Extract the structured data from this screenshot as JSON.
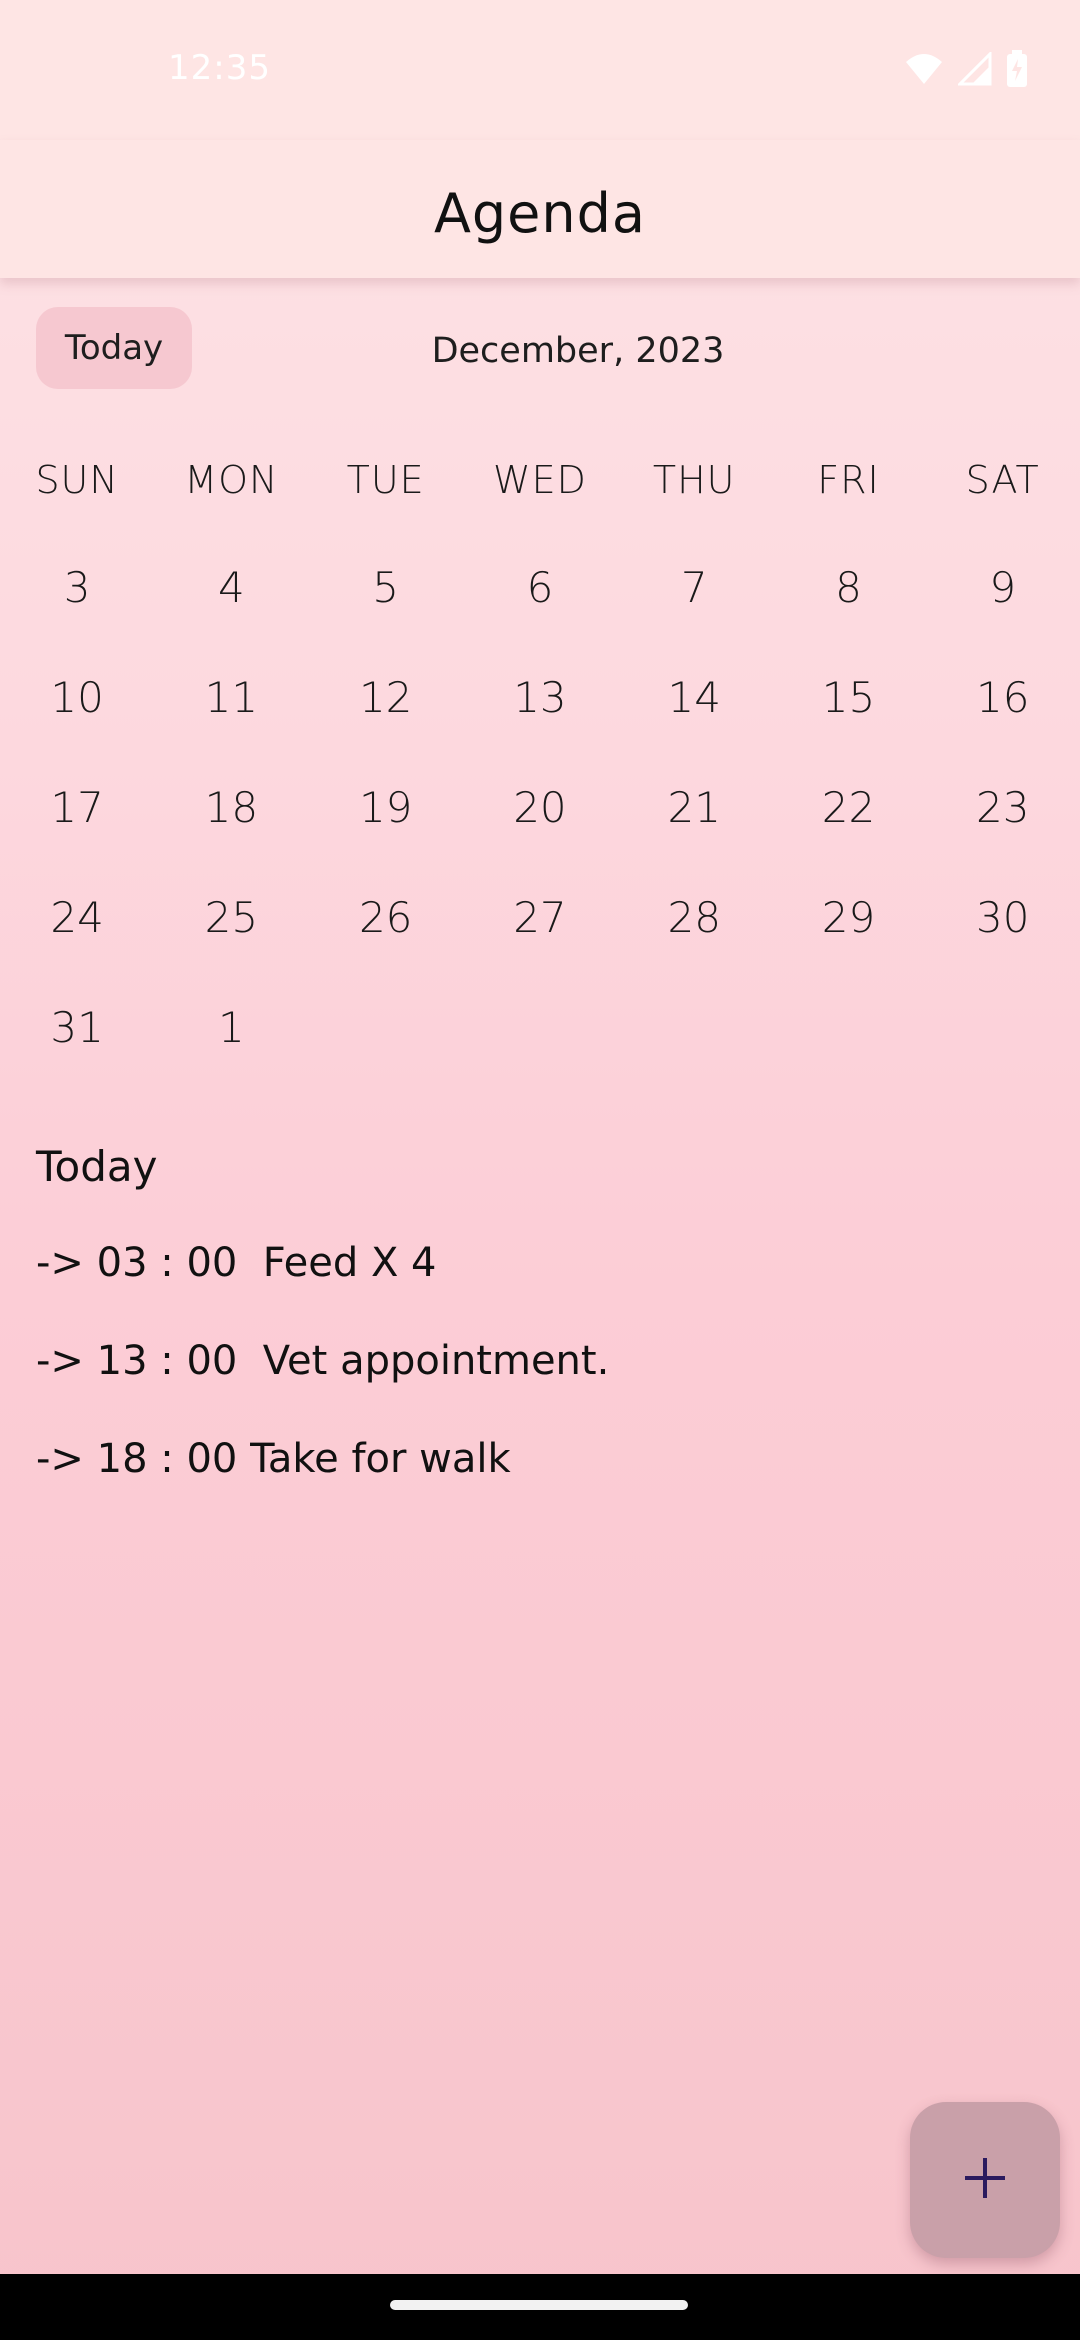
{
  "status_bar": {
    "time": "12:35",
    "icons": [
      "wifi-icon",
      "cellular-signal-icon",
      "battery-charging-icon"
    ]
  },
  "app_bar": {
    "title": "Agenda"
  },
  "calendar": {
    "today_button_label": "Today",
    "month_label": "December, 2023",
    "weekdays": [
      "SUN",
      "MON",
      "TUE",
      "WED",
      "THU",
      "FRI",
      "SAT"
    ],
    "weeks": [
      [
        "3",
        "4",
        "5",
        "6",
        "7",
        "8",
        "9"
      ],
      [
        "10",
        "11",
        "12",
        "13",
        "14",
        "15",
        "16"
      ],
      [
        "17",
        "18",
        "19",
        "20",
        "21",
        "22",
        "23"
      ],
      [
        "24",
        "25",
        "26",
        "27",
        "28",
        "29",
        "30"
      ],
      [
        "31",
        "1"
      ]
    ]
  },
  "agenda": {
    "heading": "Today",
    "items": [
      "-> 03 : 00  Feed X 4",
      "-> 13 : 00  Vet appointment.",
      "-> 18 : 00 Take for walk"
    ]
  },
  "fab": {
    "icon": "plus-icon"
  },
  "colors": {
    "background_top": "#fde4e6",
    "background_bottom": "#f7c4cb",
    "app_bar": "#fee5e4",
    "today_button": "#f6c8d0",
    "fab": "#c9a0a9",
    "fab_icon": "#2a1a5e"
  }
}
